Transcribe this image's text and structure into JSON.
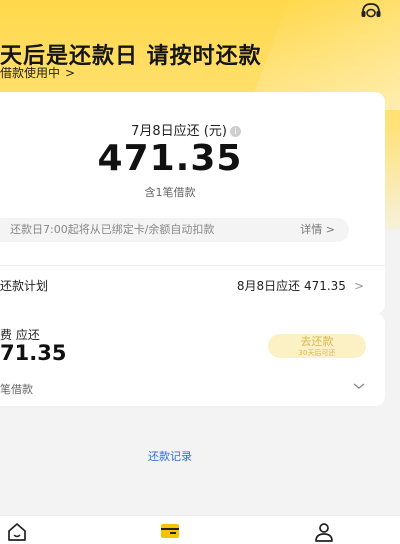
{
  "header": {
    "headline": "天后是还款日 请按时还款",
    "sub_link": "借款使用中",
    "sub_link_chevron": ">",
    "service_icon": "headset-icon"
  },
  "summary": {
    "due_label": "7月8日应还 (元)",
    "info_icon_glyph": "i",
    "amount": "471.35",
    "loan_count": "含1笔借款",
    "notice": "还款日7:00起将从已绑定卡/余额自动扣款",
    "notice_detail": "详情 >"
  },
  "plan": {
    "label": "还款计划",
    "info": "8月8日应还 471.35",
    "chevron": ">"
  },
  "loan": {
    "fee_label": "费 应还",
    "amount": "71.35",
    "button_label": "去还款",
    "button_sub": "30天后可还",
    "sub": "笔借款",
    "expand_icon": "chevron-down-icon"
  },
  "records_link": "还款记录",
  "tabbar": {
    "icons": [
      "home-icon",
      "wallet-icon",
      "user-icon"
    ],
    "active_color": "#f5c400"
  },
  "colors": {
    "brand_yellow": "#ffd84a",
    "link_blue": "#2f6fd6"
  }
}
